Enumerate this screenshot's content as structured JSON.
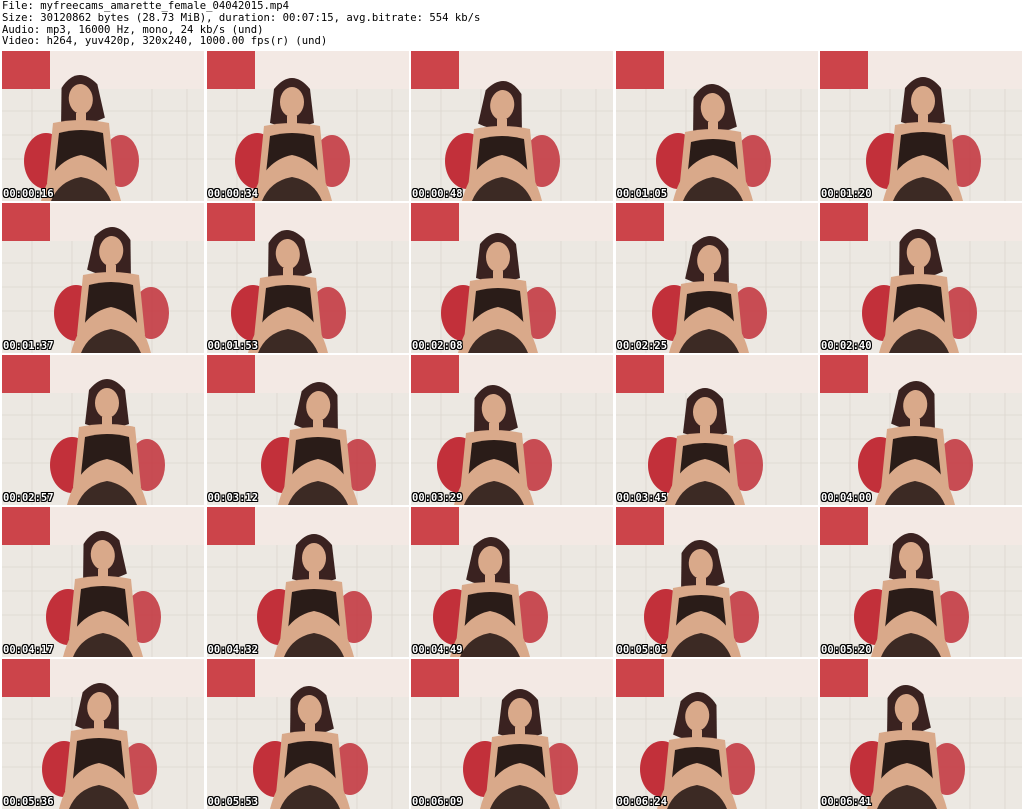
{
  "header": {
    "file": "File: myfreecams_amarette_female_04042015.mp4",
    "size": "Size: 30120862 bytes (28.73 MiB), duration: 00:07:15, avg.bitrate: 554 kb/s",
    "audio": "Audio: mp3, 16000 Hz, mono, 24 kb/s (und)",
    "video": "Video: h264, yuv420p, 320x240, 1000.00 fps(r) (und)"
  },
  "thumbnails": [
    {
      "timestamp": "00:00:16"
    },
    {
      "timestamp": "00:00:34"
    },
    {
      "timestamp": "00:00:48"
    },
    {
      "timestamp": "00:01:05"
    },
    {
      "timestamp": "00:01:20"
    },
    {
      "timestamp": "00:01:37"
    },
    {
      "timestamp": "00:01:53"
    },
    {
      "timestamp": "00:02:08"
    },
    {
      "timestamp": "00:02:25"
    },
    {
      "timestamp": "00:02:40"
    },
    {
      "timestamp": "00:02:57"
    },
    {
      "timestamp": "00:03:12"
    },
    {
      "timestamp": "00:03:29"
    },
    {
      "timestamp": "00:03:45"
    },
    {
      "timestamp": "00:04:00"
    },
    {
      "timestamp": "00:04:17"
    },
    {
      "timestamp": "00:04:32"
    },
    {
      "timestamp": "00:04:49"
    },
    {
      "timestamp": "00:05:05"
    },
    {
      "timestamp": "00:05:20"
    },
    {
      "timestamp": "00:05:36"
    },
    {
      "timestamp": "00:05:53"
    },
    {
      "timestamp": "00:06:09"
    },
    {
      "timestamp": "00:06:24"
    },
    {
      "timestamp": "00:06:41"
    }
  ],
  "colors": {
    "sofa": "#ece8e2",
    "wall": "#efe3dc",
    "curtain": "#c8323a",
    "pillow": "#c2303a",
    "skin": "#d9a98a",
    "hair": "#3a2220",
    "dress": "#2a1c18"
  }
}
